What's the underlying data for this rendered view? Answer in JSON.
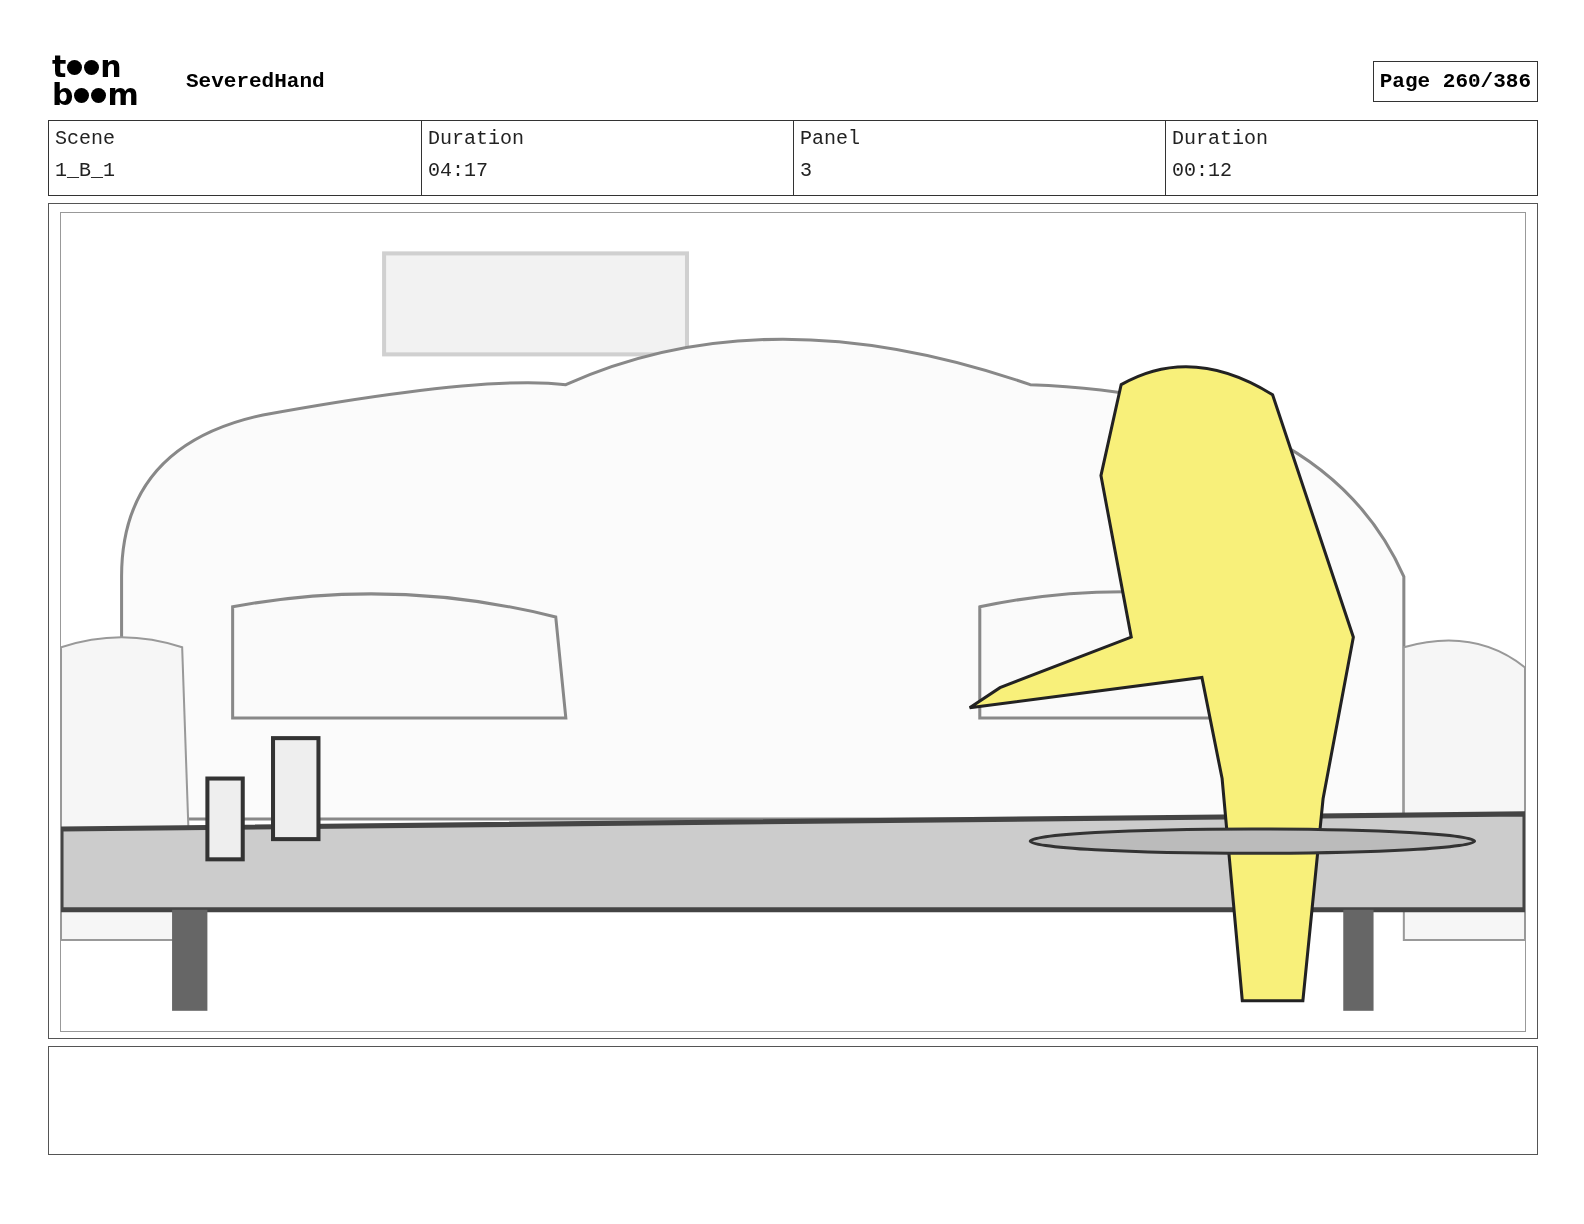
{
  "logo": [
    [
      "t",
      "n"
    ],
    [
      "b",
      "m"
    ]
  ],
  "title": "SeveredHand",
  "page": "Page 260/386",
  "info": [
    {
      "label": "Scene",
      "value": "1_B_1"
    },
    {
      "label": "Duration",
      "value": "04:17"
    },
    {
      "label": "Panel",
      "value": "3"
    },
    {
      "label": "Duration",
      "value": "00:12"
    }
  ]
}
